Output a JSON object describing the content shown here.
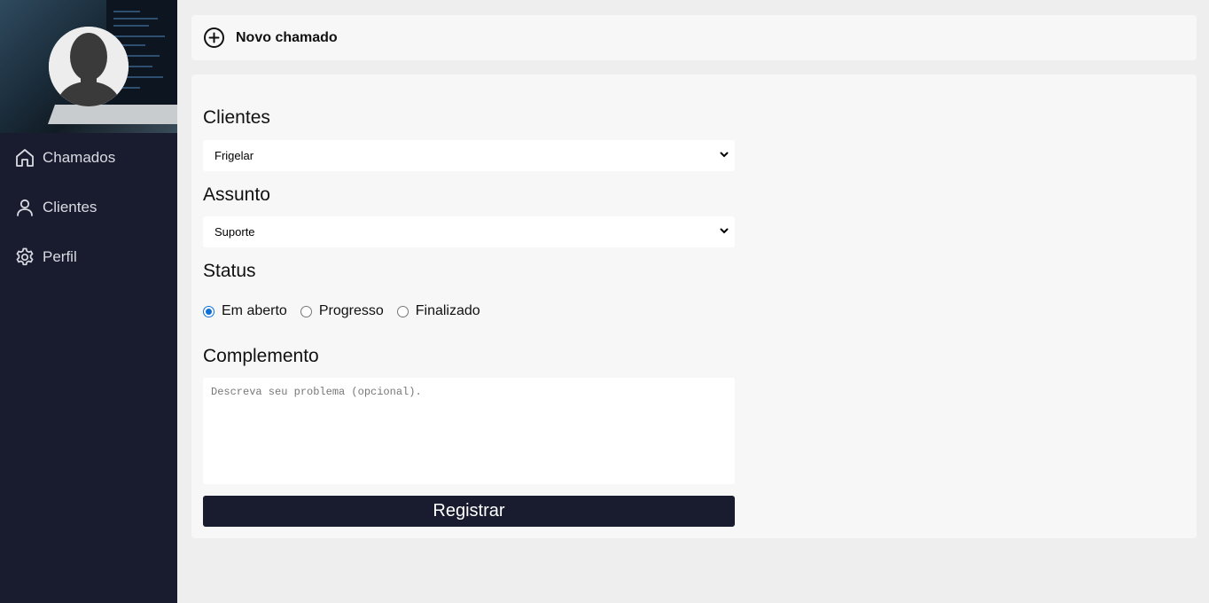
{
  "header": {
    "title": "Novo chamado",
    "icon": "plus-circle-icon"
  },
  "sidebar": {
    "items": [
      {
        "label": "Chamados",
        "icon": "home-icon"
      },
      {
        "label": "Clientes",
        "icon": "user-icon"
      },
      {
        "label": "Perfil",
        "icon": "gear-icon"
      }
    ]
  },
  "form": {
    "clientes_label": "Clientes",
    "clientes_value": "Frigelar",
    "assunto_label": "Assunto",
    "assunto_value": "Suporte",
    "status_label": "Status",
    "status_options": [
      {
        "label": "Em aberto",
        "checked": true
      },
      {
        "label": "Progresso",
        "checked": false
      },
      {
        "label": "Finalizado",
        "checked": false
      }
    ],
    "complemento_label": "Complemento",
    "complemento_placeholder": "Descreva seu problema (opcional).",
    "submit_label": "Registrar"
  },
  "colors": {
    "sidebar_bg": "#181c2e",
    "accent": "#0f6fd8",
    "button_bg": "#181c2e"
  }
}
